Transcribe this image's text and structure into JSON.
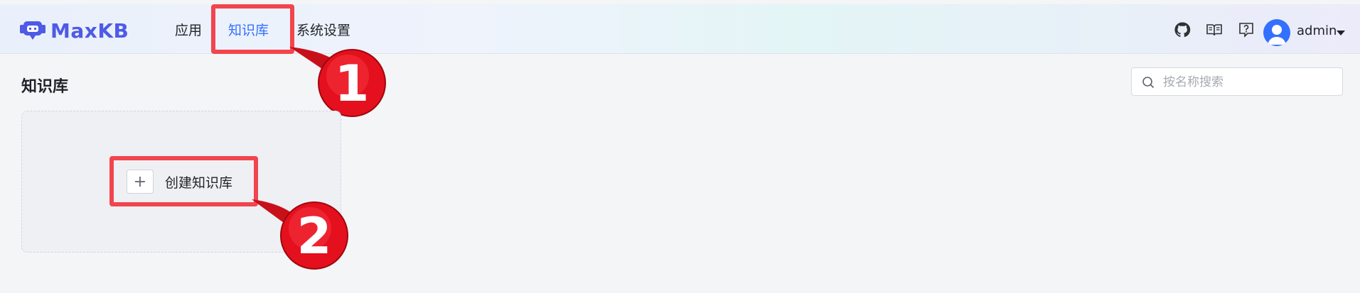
{
  "app": {
    "logo_text": "MaxKB",
    "brand_color": "#4e5be6"
  },
  "nav": {
    "items": [
      {
        "label": "应用",
        "active": false
      },
      {
        "label": "知识库",
        "active": true
      },
      {
        "label": "系统设置",
        "active": false
      }
    ]
  },
  "header_tools": {
    "icons": [
      "github-icon",
      "book-icon",
      "help-icon"
    ],
    "user_name": "admin"
  },
  "page": {
    "title": "知识库"
  },
  "search": {
    "placeholder": "按名称搜索",
    "value": ""
  },
  "create_card": {
    "label": "创建知识库",
    "plus": "+"
  },
  "callouts": {
    "first": "1",
    "second": "2",
    "color": "#f2454d"
  }
}
